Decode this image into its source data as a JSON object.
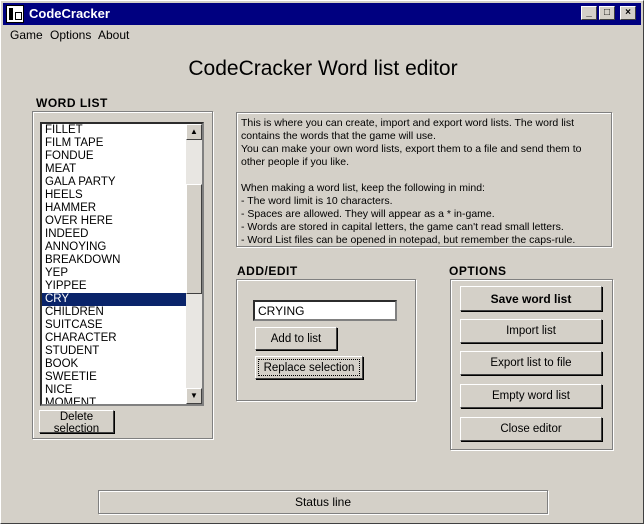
{
  "window": {
    "title": "CodeCracker",
    "minimize": "_",
    "maximize": "□",
    "close": "×"
  },
  "menu": {
    "items": [
      {
        "label": "Game"
      },
      {
        "label": "Options"
      },
      {
        "label": "About"
      }
    ]
  },
  "page_title": "CodeCracker Word list editor",
  "word_list": {
    "label": "WORD LIST",
    "items": [
      "FILLET",
      "FILM TAPE",
      "FONDUE",
      "MEAT",
      "GALA PARTY",
      "HEELS",
      "HAMMER",
      "OVER HERE",
      "INDEED",
      "ANNOYING",
      "BREAKDOWN",
      "YEP",
      "YIPPEE",
      "CRY",
      "CHILDREN",
      "SUITCASE",
      "CHARACTER",
      "STUDENT",
      "BOOK",
      "SWEETIE",
      "NICE",
      "MOMENT"
    ],
    "selected": "CRY",
    "delete_label": "Delete selection"
  },
  "info": {
    "lines": [
      "This is where you can create, import and export word lists. The word list",
      "contains the words that the game will use.",
      "You can make your own word lists, export them to a file and send them to",
      "other people if you like.",
      "",
      "When making a word list, keep the following in mind:",
      "- The word limit is 10 characters.",
      "- Spaces are allowed. They will appear as a * in-game.",
      "- Words are stored in capital letters, the game can't read small letters.",
      "- Word List files can be opened in notepad, but remember the caps-rule."
    ]
  },
  "add_edit": {
    "label": "ADD/EDIT",
    "input_value": "CRYING",
    "add_label": "Add to list",
    "replace_label": "Replace selection"
  },
  "options": {
    "label": "OPTIONS",
    "save": "Save word list",
    "import": "Import list",
    "export": "Export list to file",
    "empty": "Empty word list",
    "close": "Close editor"
  },
  "status": "Status line"
}
